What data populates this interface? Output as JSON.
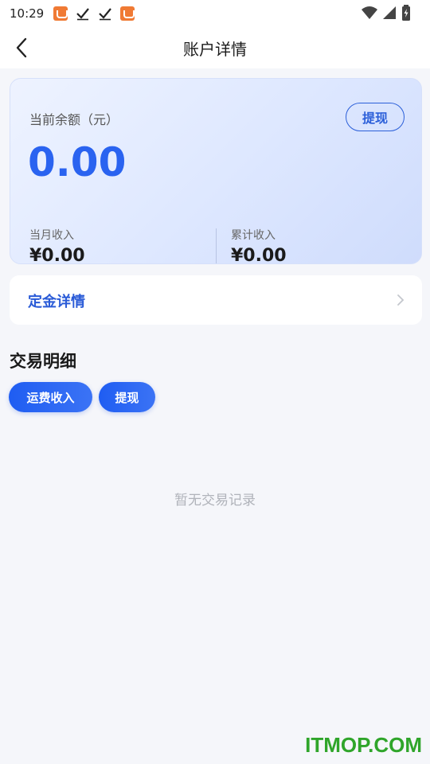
{
  "status_bar": {
    "time": "10:29",
    "left_icons": [
      "app-notification-icon",
      "check-icon",
      "check-icon",
      "app-notification-icon"
    ],
    "right_icons": [
      "wifi-icon",
      "signal-icon",
      "battery-charging-icon"
    ]
  },
  "nav": {
    "title": "账户详情",
    "back_icon": "back-icon"
  },
  "balance_card": {
    "label": "当前余额（元）",
    "withdraw_button": "提现",
    "balance": "0.00",
    "month_income_label": "当月收入",
    "month_income_value": "¥0.00",
    "total_income_label": "累计收入",
    "total_income_value": "¥0.00"
  },
  "deposit": {
    "label": "定金详情"
  },
  "transactions": {
    "title": "交易明细",
    "filters": [
      "运费收入",
      "提现"
    ],
    "empty_text": "暂无交易记录"
  },
  "watermark": "ITMOP.COM",
  "colors": {
    "accent": "#2a63f0",
    "deposit_text": "#2a5bd7",
    "background": "#f5f6fa",
    "watermark": "#2fa52a"
  }
}
